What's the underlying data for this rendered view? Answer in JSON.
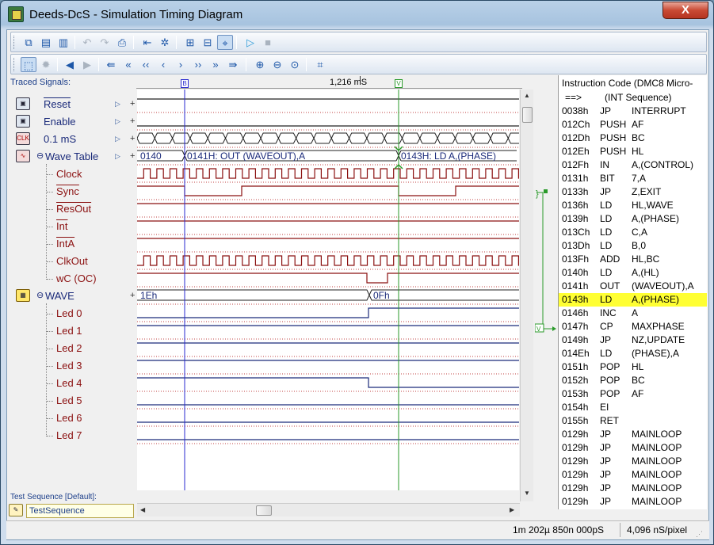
{
  "window": {
    "title": "Deeds-DcS  -  Simulation Timing Diagram",
    "close": "X"
  },
  "panel": {
    "traced_signals": "Traced Signals:",
    "ruler_time": "1,216 mS"
  },
  "signals": [
    {
      "label": "Reset",
      "overline": true,
      "color": "blue",
      "icon": "input-switch-icon"
    },
    {
      "label": "Enable",
      "overline": false,
      "color": "blue",
      "icon": "input-switch-icon"
    },
    {
      "label": "0.1 mS",
      "overline": false,
      "color": "blue",
      "icon": "clock-generator-icon",
      "icon_text": "CLK"
    },
    {
      "label": "Wave Table",
      "overline": false,
      "color": "blue",
      "icon": "wave-table-icon",
      "collapse": "⊖"
    },
    {
      "label": "Clock",
      "overline": false,
      "color": "red"
    },
    {
      "label": "Sync",
      "overline": true,
      "color": "red"
    },
    {
      "label": "ResOut",
      "overline": true,
      "color": "red"
    },
    {
      "label": "Int",
      "overline": true,
      "color": "red"
    },
    {
      "label": "IntA",
      "overline": true,
      "color": "red"
    },
    {
      "label": "ClkOut",
      "overline": false,
      "color": "red"
    },
    {
      "label": "wC (OC)",
      "overline": false,
      "color": "red"
    },
    {
      "label": "WAVE",
      "overline": false,
      "color": "blue",
      "icon": "chip-icon",
      "collapse": "⊖"
    },
    {
      "label": "Led 0",
      "overline": false,
      "color": "red"
    },
    {
      "label": "Led 1",
      "overline": false,
      "color": "red"
    },
    {
      "label": "Led 2",
      "overline": false,
      "color": "red"
    },
    {
      "label": "Led 3",
      "overline": false,
      "color": "red"
    },
    {
      "label": "Led 4",
      "overline": false,
      "color": "red"
    },
    {
      "label": "Led 5",
      "overline": false,
      "color": "red"
    },
    {
      "label": "Led 6",
      "overline": false,
      "color": "red"
    },
    {
      "label": "Led 7",
      "overline": false,
      "color": "red"
    }
  ],
  "waveform_labels": {
    "wave_table": [
      "0140",
      "0141H: OUT  (WAVEOUT),A",
      "0143H: LD   A,(PHASE)"
    ],
    "wave_bus": [
      "1Eh",
      "0Fh"
    ],
    "cursor_a": "B",
    "cursor_b": "V"
  },
  "code": {
    "header": "Instruction Code  (DMC8 Micro-",
    "arrow": "==>",
    "subheader": "(INT  Sequence)",
    "rows": [
      {
        "adr": "0038h",
        "mn": "JP",
        "op": "INTERRUPT"
      },
      {
        "adr": "012Ch",
        "mn": "PUSH",
        "op": "AF"
      },
      {
        "adr": "012Dh",
        "mn": "PUSH",
        "op": "BC"
      },
      {
        "adr": "012Eh",
        "mn": "PUSH",
        "op": "HL"
      },
      {
        "adr": "012Fh",
        "mn": "IN",
        "op": "A,(CONTROL)"
      },
      {
        "adr": "0131h",
        "mn": "BIT",
        "op": "7,A"
      },
      {
        "adr": "0133h",
        "mn": "JP",
        "op": "Z,EXIT"
      },
      {
        "adr": "0136h",
        "mn": "LD",
        "op": "HL,WAVE"
      },
      {
        "adr": "0139h",
        "mn": "LD",
        "op": "A,(PHASE)"
      },
      {
        "adr": "013Ch",
        "mn": "LD",
        "op": "C,A"
      },
      {
        "adr": "013Dh",
        "mn": "LD",
        "op": "B,0"
      },
      {
        "adr": "013Fh",
        "mn": "ADD",
        "op": "HL,BC"
      },
      {
        "adr": "0140h",
        "mn": "LD",
        "op": "A,(HL)"
      },
      {
        "adr": "0141h",
        "mn": "OUT",
        "op": "(WAVEOUT),A"
      },
      {
        "adr": "0143h",
        "mn": "LD",
        "op": "A,(PHASE)",
        "highlight": true
      },
      {
        "adr": "0146h",
        "mn": "INC",
        "op": "A"
      },
      {
        "adr": "0147h",
        "mn": "CP",
        "op": "MAXPHASE"
      },
      {
        "adr": "0149h",
        "mn": "JP",
        "op": "NZ,UPDATE"
      },
      {
        "adr": "014Eh",
        "mn": "LD",
        "op": "(PHASE),A"
      },
      {
        "adr": "0151h",
        "mn": "POP",
        "op": "HL"
      },
      {
        "adr": "0152h",
        "mn": "POP",
        "op": "BC"
      },
      {
        "adr": "0153h",
        "mn": "POP",
        "op": "AF"
      },
      {
        "adr": "0154h",
        "mn": "EI",
        "op": ""
      },
      {
        "adr": "0155h",
        "mn": "RET",
        "op": ""
      },
      {
        "adr": "0129h",
        "mn": "JP",
        "op": "MAINLOOP"
      },
      {
        "adr": "0129h",
        "mn": "JP",
        "op": "MAINLOOP"
      },
      {
        "adr": "0129h",
        "mn": "JP",
        "op": "MAINLOOP"
      },
      {
        "adr": "0129h",
        "mn": "JP",
        "op": "MAINLOOP"
      },
      {
        "adr": "0129h",
        "mn": "JP",
        "op": "MAINLOOP"
      },
      {
        "adr": "0129h",
        "mn": "JP",
        "op": "MAINLOOP"
      }
    ]
  },
  "test_sequence": {
    "label": "Test Sequence  [Default]:",
    "value": "TestSequence"
  },
  "status": {
    "time": "1m 202µ 850n 000pS",
    "scale": "4,096 nS/pixel"
  },
  "colors": {
    "red_signal": "#8b1010",
    "blue_signal": "#1a2a7a",
    "cursor_a": "#2a2ad0",
    "cursor_b": "#2a9a2a",
    "highlight": "#ffff33"
  }
}
